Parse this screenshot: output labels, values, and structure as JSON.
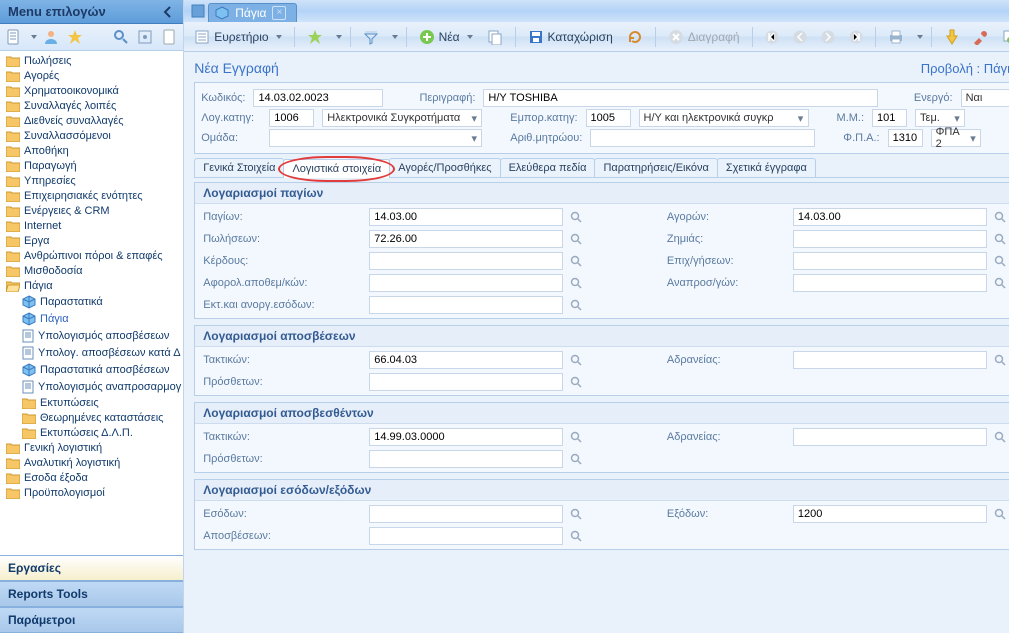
{
  "sidebar": {
    "title": "Menu επιλογών",
    "tree": [
      {
        "icon": "folder",
        "label": "Πωλήσεις",
        "indent": 0
      },
      {
        "icon": "folder",
        "label": "Αγορές",
        "indent": 0
      },
      {
        "icon": "folder",
        "label": "Χρηματοοικονομικά",
        "indent": 0
      },
      {
        "icon": "folder",
        "label": "Συναλλαγές λοιπές",
        "indent": 0
      },
      {
        "icon": "folder",
        "label": "Διεθνείς συναλλαγές",
        "indent": 0
      },
      {
        "icon": "folder",
        "label": "Συναλλασσόμενοι",
        "indent": 0
      },
      {
        "icon": "folder",
        "label": "Αποθήκη",
        "indent": 0
      },
      {
        "icon": "folder",
        "label": "Παραγωγή",
        "indent": 0
      },
      {
        "icon": "folder",
        "label": "Υπηρεσίες",
        "indent": 0
      },
      {
        "icon": "folder",
        "label": "Επιχειρησιακές ενότητες",
        "indent": 0
      },
      {
        "icon": "folder",
        "label": "Ενέργειες & CRM",
        "indent": 0
      },
      {
        "icon": "folder",
        "label": "Internet",
        "indent": 0
      },
      {
        "icon": "folder",
        "label": "Εργα",
        "indent": 0
      },
      {
        "icon": "folder",
        "label": "Ανθρώπινοι πόροι & επαφές",
        "indent": 0
      },
      {
        "icon": "folder",
        "label": "Μισθοδοσία",
        "indent": 0
      },
      {
        "icon": "folder-open",
        "label": "Πάγια",
        "indent": 0
      },
      {
        "icon": "cube",
        "label": "Παραστατικά",
        "indent": 1
      },
      {
        "icon": "cube",
        "label": "Πάγια",
        "indent": 1,
        "selected": true
      },
      {
        "icon": "doc",
        "label": "Υπολογισμός αποσβέσεων",
        "indent": 1
      },
      {
        "icon": "doc",
        "label": "Υπολογ. αποσβέσεων κατά Δ",
        "indent": 1
      },
      {
        "icon": "cube",
        "label": "Παραστατικά αποσβέσεων",
        "indent": 1
      },
      {
        "icon": "doc",
        "label": "Υπολογισμός αναπροσαρμογ",
        "indent": 1
      },
      {
        "icon": "folder",
        "label": "Εκτυπώσεις",
        "indent": 1
      },
      {
        "icon": "folder",
        "label": "Θεωρημένες καταστάσεις",
        "indent": 1
      },
      {
        "icon": "folder",
        "label": "Εκτυπώσεις Δ.Λ.Π.",
        "indent": 1
      },
      {
        "icon": "folder",
        "label": "Γενική λογιστική",
        "indent": 0
      },
      {
        "icon": "folder",
        "label": "Αναλυτική λογιστική",
        "indent": 0
      },
      {
        "icon": "folder",
        "label": "Εσοδα έξοδα",
        "indent": 0
      },
      {
        "icon": "folder",
        "label": "Προϋπολογισμοί",
        "indent": 0
      }
    ],
    "sections": [
      {
        "label": "Εργασίες",
        "active": true
      },
      {
        "label": "Reports Tools",
        "active": false
      },
      {
        "label": "Παράμετροι",
        "active": false
      }
    ]
  },
  "window": {
    "tab_title": "Πάγια"
  },
  "toolbar": {
    "index": "Ευρετήριο",
    "new": "Νέα",
    "save": "Καταχώριση",
    "delete": "Διαγραφή"
  },
  "header": {
    "new_record": "Νέα Εγγραφή",
    "view_label": "Προβολή : Πάγια"
  },
  "form": {
    "code_label": "Κωδικός:",
    "code_value": "14.03.02.0023",
    "desc_label": "Περιγραφή:",
    "desc_value": "Η/Υ TOSHIBA",
    "active_label": "Ενεργό:",
    "active_value": "Ναι",
    "acc_cat_label": "Λογ.κατηγ:",
    "acc_cat_code": "1006",
    "acc_cat_text": "Ηλεκτρονικά Συγκροτήματα",
    "comm_cat_label": "Εμπορ.κατηγ:",
    "comm_cat_code": "1005",
    "comm_cat_text": "Η/Υ και ηλεκτρονικά συγκρ",
    "unit_label": "Μ.Μ.:",
    "unit_code": "101",
    "unit_text": "Τεμ.",
    "group_label": "Ομάδα:",
    "registry_label": "Αριθ.μητρώου:",
    "registry_value": "",
    "vat_label": "Φ.Π.Α.:",
    "vat_code": "1310",
    "vat_text": "ΦΠΑ 2"
  },
  "tabs": [
    {
      "label": "Γενικά Στοιχεία"
    },
    {
      "label": "Λογιστικά στοιχεία",
      "active": true,
      "circled": true
    },
    {
      "label": "Αγορές/Προσθήκες"
    },
    {
      "label": "Ελεύθερα πεδία"
    },
    {
      "label": "Παρατηρήσεις/Εικόνα"
    },
    {
      "label": "Σχετικά έγγραφα"
    }
  ],
  "sections": {
    "assets": {
      "title": "Λογαριασμοί παγίων",
      "rows": [
        {
          "l1": "Παγίων:",
          "v1": "14.03.00",
          "l2": "Αγορών:",
          "v2": "14.03.00"
        },
        {
          "l1": "Πωλήσεων:",
          "v1": "72.26.00",
          "l2": "Ζημιάς:",
          "v2": ""
        },
        {
          "l1": "Κέρδους:",
          "v1": "",
          "l2": "Επιχ/γήσεων:",
          "v2": ""
        },
        {
          "l1": "Αφορολ.αποθεμ/κών:",
          "v1": "",
          "l2": "Αναπροσ/γών:",
          "v2": ""
        },
        {
          "l1": "Εκτ.και ανοργ.εσόδων:",
          "v1": ""
        }
      ]
    },
    "depr": {
      "title": "Λογαριασμοί αποσβέσεων",
      "rows": [
        {
          "l1": "Τακτικών:",
          "v1": "66.04.03",
          "l2": "Αδρανείας:",
          "v2": ""
        },
        {
          "l1": "Πρόσθετων:",
          "v1": ""
        }
      ]
    },
    "deprd": {
      "title": "Λογαριασμοί αποσβεσθέντων",
      "rows": [
        {
          "l1": "Τακτικών:",
          "v1": "14.99.03.0000",
          "l2": "Αδρανείας:",
          "v2": ""
        },
        {
          "l1": "Πρόσθετων:",
          "v1": ""
        }
      ]
    },
    "incexp": {
      "title": "Λογαριασμοί εσόδων/εξόδων",
      "rows": [
        {
          "l1": "Εσόδων:",
          "v1": "",
          "l2": "Εξόδων:",
          "v2": "1200"
        },
        {
          "l1": "Αποσβέσεων:",
          "v1": ""
        }
      ]
    }
  }
}
